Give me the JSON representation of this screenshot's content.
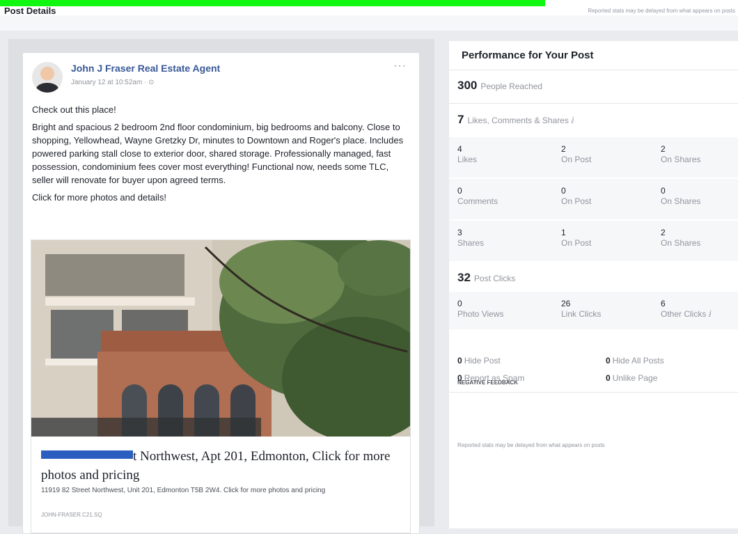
{
  "page": {
    "title": "Post Details",
    "top_note": "Reported stats may be delayed from what appears on posts"
  },
  "post": {
    "author": "John J Fraser Real Estate Agent",
    "timestamp": "January 12 at 10:52am · ⊙",
    "more_menu": "···",
    "body": [
      "Check out this place!",
      "Bright and spacious 2 bedroom 2nd floor condominium, big bedrooms and balcony. Close to shopping, Yellowhead, Wayne Gretzky Dr, minutes to Downtown and Roger's place. Includes powered parking stall close to exterior door, shared storage. Professionally managed, fast possession, condominium fees cover most everything! Functional now, needs some TLC, seller will renovate for buyer upon agreed terms.",
      "Click for more photos and details!"
    ],
    "link": {
      "title_after_redaction": "t Northwest, Apt 201, Edmonton, Click for more photos and pricing",
      "description": "11919 82 Street Northwest, Unit 201, Edmonton T5B 2W4. Click for more photos and pricing",
      "domain": "JOHN-FRASER.C21.SQ"
    }
  },
  "performance": {
    "title": "Performance for Your Post",
    "reached": {
      "value": "300",
      "label": "People Reached"
    },
    "engagement": {
      "value": "7",
      "label": "Likes, Comments & Shares ⅈ"
    },
    "likes": [
      {
        "value": "4",
        "label": "Likes"
      },
      {
        "value": "2",
        "label": "On Post"
      },
      {
        "value": "2",
        "label": "On Shares"
      }
    ],
    "comments": [
      {
        "value": "0",
        "label": "Comments"
      },
      {
        "value": "0",
        "label": "On Post"
      },
      {
        "value": "0",
        "label": "On Shares"
      }
    ],
    "shares": [
      {
        "value": "3",
        "label": "Shares"
      },
      {
        "value": "1",
        "label": "On Post"
      },
      {
        "value": "2",
        "label": "On Shares"
      }
    ],
    "clicks": {
      "value": "32",
      "label": "Post Clicks"
    },
    "click_breakdown": [
      {
        "value": "0",
        "label": "Photo Views"
      },
      {
        "value": "26",
        "label": "Link Clicks"
      },
      {
        "value": "6",
        "label": "Other Clicks ⅈ"
      }
    ],
    "negative_feedback": {
      "title": "NEGATIVE FEEDBACK",
      "items": [
        {
          "value": "0",
          "label": "Hide Post"
        },
        {
          "value": "0",
          "label": "Hide All Posts"
        },
        {
          "value": "0",
          "label": "Report as Spam"
        },
        {
          "value": "0",
          "label": "Unlike Page"
        }
      ]
    },
    "note": "Reported stats may be delayed from what appears on posts"
  }
}
